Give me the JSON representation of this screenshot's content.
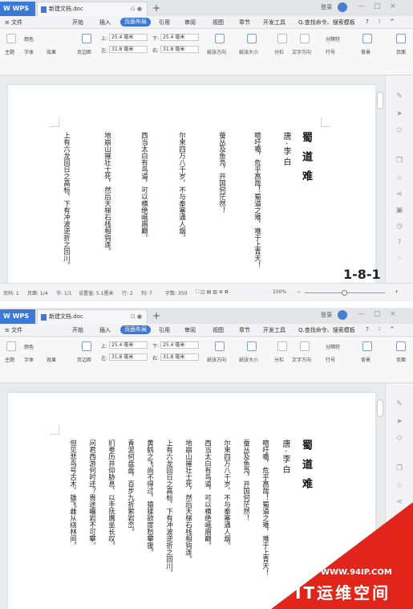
{
  "tabbar": {
    "wps_label": "WPS",
    "doc_title": "新建文档.doc",
    "tab_marks": "⊡ ●",
    "new_tab": "+",
    "login": "登录",
    "min": "—",
    "max": "□",
    "close": "×"
  },
  "menubar": {
    "file": "≡ 文件",
    "items": [
      "开始",
      "插入",
      "页面布局",
      "引用",
      "审阅",
      "视图",
      "章节",
      "开发工具"
    ],
    "active": "页面布局",
    "search": "Q.查找命令、搜索模板",
    "help": "?",
    "more": "⁝",
    "collapse": "^"
  },
  "toolbar": {
    "theme": "主题",
    "colors": "颜色",
    "fonts": "字体",
    "effects": "效果",
    "margins": "页边距",
    "top_label": "上:",
    "top_value": "25.4 毫米",
    "bottom_label": "下:",
    "bottom_value": "25.4 毫米",
    "left_label": "左:",
    "left_value": "31.8 毫米",
    "right_label": "右:",
    "right_value": "31.8 毫米",
    "orientation": "纸张方向",
    "size": "纸张大小",
    "columns": "分栏",
    "text_direction": "文字方向",
    "breaks": "分隔符",
    "line_numbers": "行号",
    "background": "背景",
    "page_border": "页面"
  },
  "doc1": {
    "title": "蜀道难",
    "author": "唐·李白",
    "lines": [
      "噫吁嚱，危乎高哉！蜀道之难，难于上青天！",
      "蚕丛及鱼凫，开国何茫然！",
      "尔来四万八千岁，不与秦塞通人烟。",
      "西当太白有鸟道，可以横绝峨眉巅。",
      "地崩山摧壮士死，然后天梯石栈相钩连。",
      "上有六龙回日之高标，下有冲波逆折之回川。"
    ]
  },
  "doc2": {
    "title": "蜀道难",
    "author": "唐·李白",
    "lines": [
      "噫吁嚱，危乎高哉！蜀道之难，难于上青天！",
      "蚕丛及鱼凫，开国何茫然！",
      "尔来四万八千岁，不与秦塞通人烟。",
      "西当太白有鸟道，可以横绝峨眉巅。",
      "地崩山摧壮士死，然后天梯石栈相钩连。",
      "上有六龙回日之高标，下有冲波逆折之回川。",
      "黄鹤之飞尚不得过，猿猱欲度愁攀援。",
      "青泥何盘盘，百步九折萦岩峦。",
      "扪参历井仰胁息，以手抚膺坐长叹。",
      "问君西游何时还？畏途巉岩不可攀。",
      "但见悲鸟号古木，雄飞雌从绕林间。"
    ]
  },
  "status": {
    "page": "页码: 1",
    "pages": "页面: 1/4",
    "section": "节: 1/1",
    "setting": "设置值: 5.1厘米",
    "row": "行: 2",
    "col": "列: 7",
    "words": "字数: 350",
    "zoom": "100%",
    "zoom_minus": "−",
    "zoom_plus": "+"
  },
  "figure_label": "1-8-1",
  "watermark": {
    "site": "WWW.94IP.COM",
    "brand": "IT运维空间"
  }
}
